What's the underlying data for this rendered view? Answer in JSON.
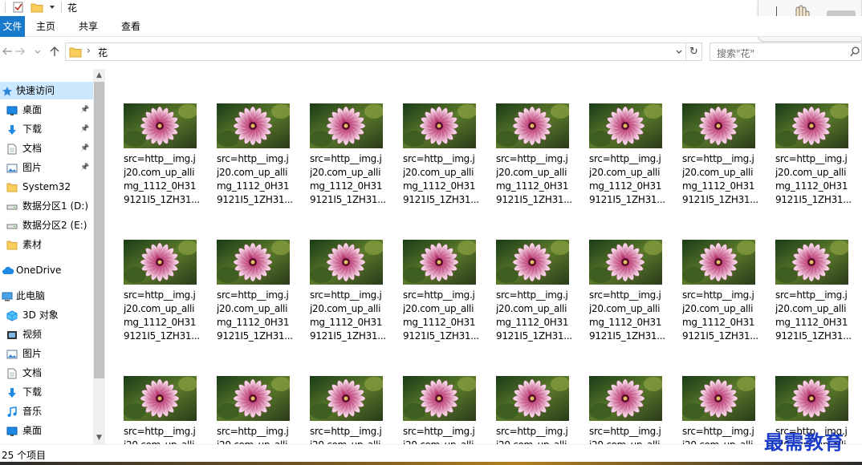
{
  "window": {
    "title": "花"
  },
  "ribbon": {
    "tabs": [
      "文件",
      "主页",
      "共享",
      "查看"
    ]
  },
  "address": {
    "path": "花",
    "search_placeholder": "搜索\"花\""
  },
  "sidebar": {
    "items": [
      {
        "label": "快速访问",
        "icon": "star-icon",
        "pinned": false,
        "selected": true
      },
      {
        "label": "桌面",
        "icon": "desktop-icon",
        "pinned": true
      },
      {
        "label": "下载",
        "icon": "download-icon",
        "pinned": true
      },
      {
        "label": "文档",
        "icon": "document-icon",
        "pinned": true
      },
      {
        "label": "图片",
        "icon": "picture-icon",
        "pinned": true
      },
      {
        "label": "System32",
        "icon": "folder-icon",
        "pinned": false
      },
      {
        "label": "数据分区1 (D:)",
        "icon": "drive-icon",
        "pinned": false
      },
      {
        "label": "数据分区2 (E:)",
        "icon": "drive-icon",
        "pinned": false
      },
      {
        "label": "素材",
        "icon": "folder-icon",
        "pinned": false
      },
      {
        "label": "OneDrive",
        "icon": "cloud-icon",
        "pinned": false
      },
      {
        "label": "此电脑",
        "icon": "computer-icon",
        "pinned": false
      },
      {
        "label": "3D 对象",
        "icon": "cube-icon",
        "pinned": false
      },
      {
        "label": "视频",
        "icon": "video-icon",
        "pinned": false
      },
      {
        "label": "图片",
        "icon": "picture-icon",
        "pinned": false
      },
      {
        "label": "文档",
        "icon": "document-icon",
        "pinned": false
      },
      {
        "label": "下载",
        "icon": "download-icon",
        "pinned": false
      },
      {
        "label": "音乐",
        "icon": "music-icon",
        "pinned": false
      },
      {
        "label": "桌面",
        "icon": "desktop-icon",
        "pinned": false
      }
    ]
  },
  "files": {
    "name_lines": [
      "src=http__img.j",
      "j20.com_up_alli",
      "mg_1112_0H31",
      "9121I5_1ZH31..."
    ],
    "partial_lines": [
      "src=http__img.j",
      "j20.com_up_alli"
    ],
    "thumbnail": "flower-thumbnail"
  },
  "status": {
    "item_count": "25 个项目"
  },
  "watermark": {
    "text": "最需教育"
  }
}
